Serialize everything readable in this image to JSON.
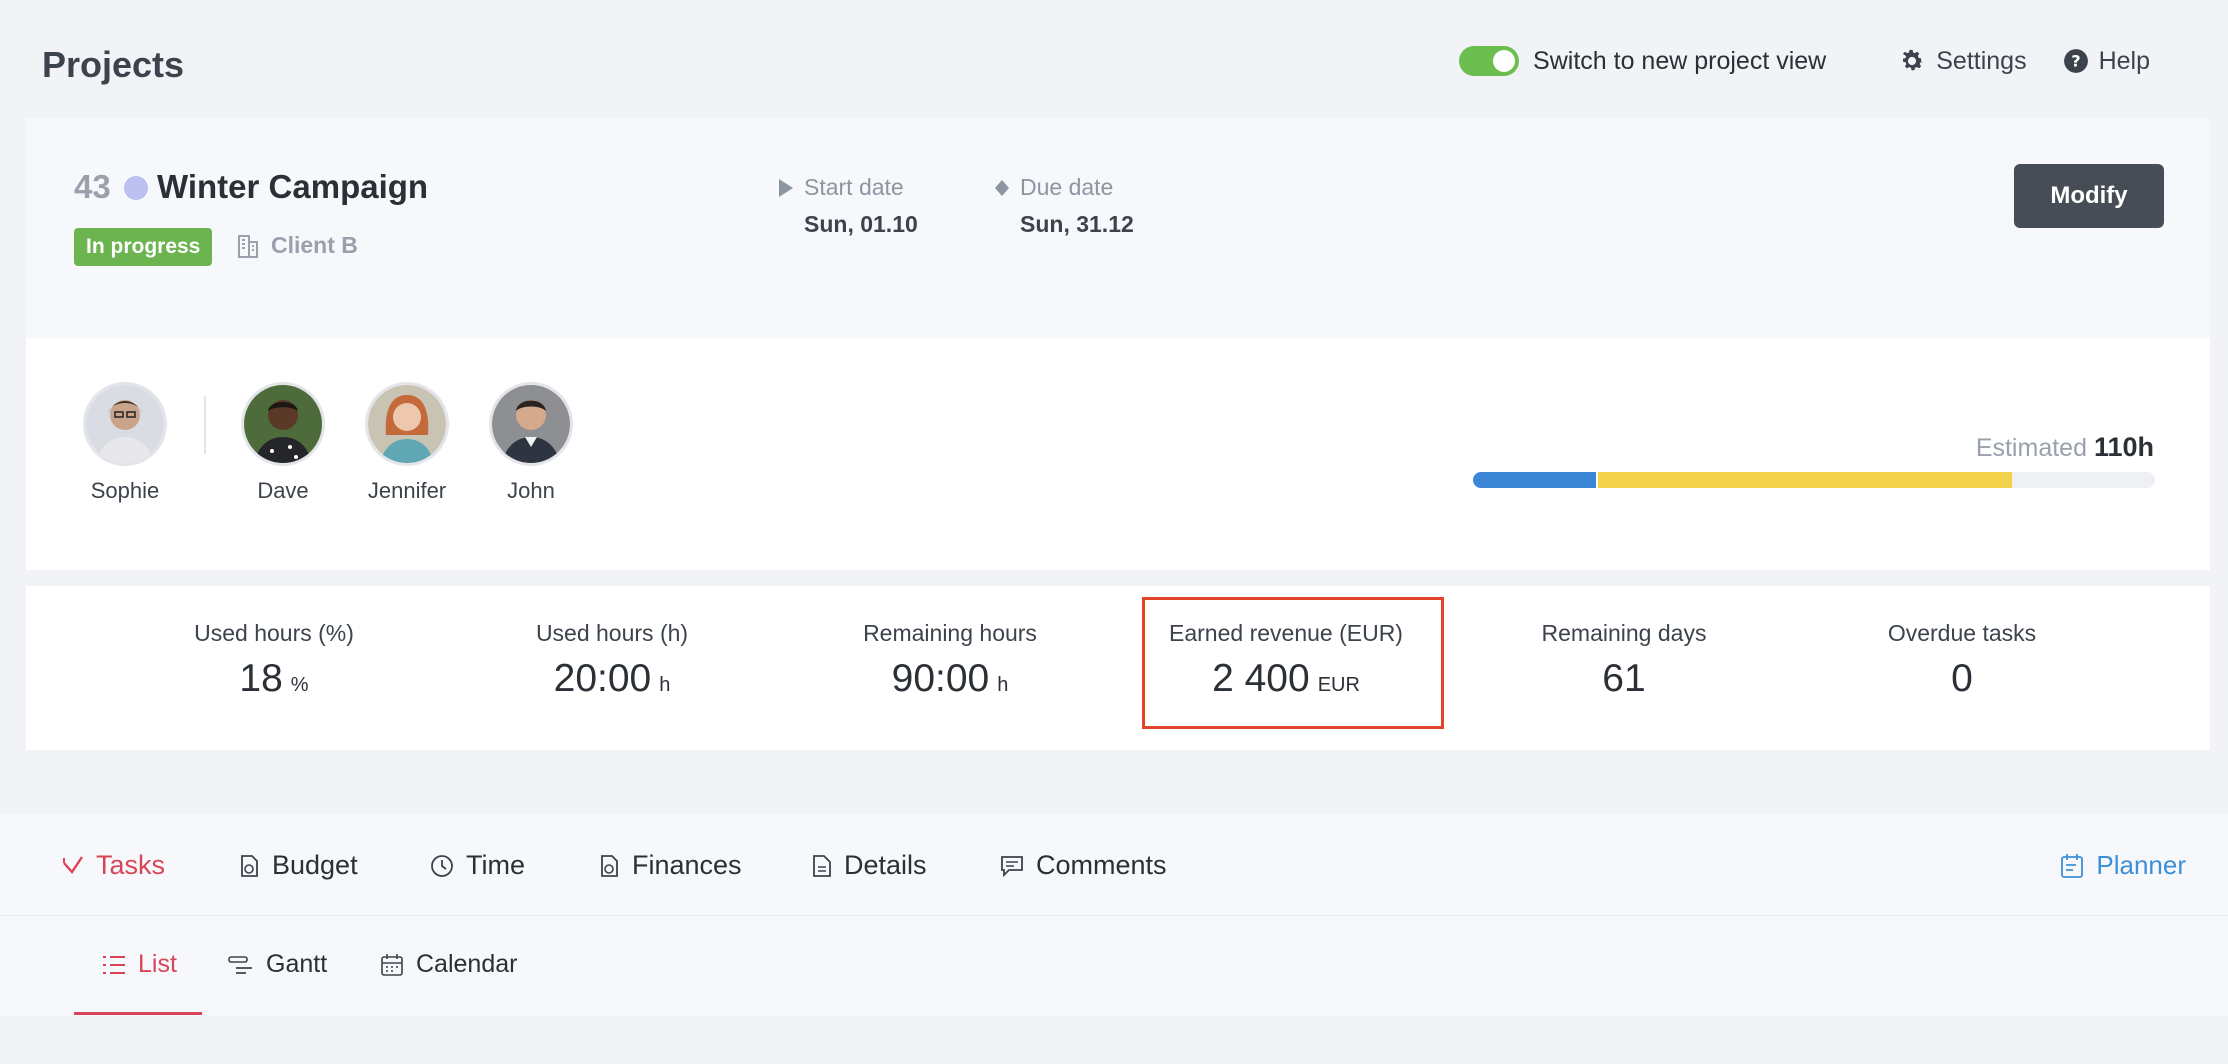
{
  "header": {
    "title": "Projects",
    "toggle_label": "Switch to new project view",
    "toggle_on": true,
    "settings_label": "Settings",
    "help_label": "Help"
  },
  "project": {
    "number": "43",
    "name": "Winter Campaign",
    "status": "In progress",
    "client": "Client B",
    "start_label": "Start date",
    "start_value": "Sun, 01.10",
    "due_label": "Due date",
    "due_value": "Sun, 31.12",
    "modify_label": "Modify",
    "dot_color": "#bcc0ee",
    "status_color": "#6cb44f"
  },
  "team": {
    "members": [
      {
        "name": "Sophie"
      },
      {
        "name": "Dave"
      },
      {
        "name": "Jennifer"
      },
      {
        "name": "John"
      }
    ]
  },
  "estimate": {
    "label": "Estimated",
    "value": "110h",
    "segments": [
      {
        "fraction": 0.18,
        "color": "#3c86d6"
      },
      {
        "fraction": 0.61,
        "color": "#f5d24b"
      }
    ]
  },
  "stats": [
    {
      "label": "Used hours (%)",
      "value": "18",
      "unit": "%"
    },
    {
      "label": "Used hours (h)",
      "value": "20:00",
      "unit": "h"
    },
    {
      "label": "Remaining hours",
      "value": "90:00",
      "unit": "h"
    },
    {
      "label": "Earned revenue (EUR)",
      "value": "2 400",
      "unit": "EUR"
    },
    {
      "label": "Remaining days",
      "value": "61",
      "unit": ""
    },
    {
      "label": "Overdue tasks",
      "value": "0",
      "unit": ""
    }
  ],
  "tabs": [
    {
      "label": "Tasks",
      "icon": "check-icon",
      "active": true
    },
    {
      "label": "Budget",
      "icon": "budget-icon"
    },
    {
      "label": "Time",
      "icon": "clock-icon"
    },
    {
      "label": "Finances",
      "icon": "finances-icon"
    },
    {
      "label": "Details",
      "icon": "document-icon"
    },
    {
      "label": "Comments",
      "icon": "comment-icon"
    }
  ],
  "planner_label": "Planner",
  "subtabs": [
    {
      "label": "List",
      "icon": "list-icon",
      "active": true
    },
    {
      "label": "Gantt",
      "icon": "gantt-icon"
    },
    {
      "label": "Calendar",
      "icon": "calendar-icon"
    }
  ],
  "colors": {
    "accent": "#d94457",
    "link": "#3d8fd6",
    "highlight": "#e0442b",
    "toggle": "#6cbf4f"
  }
}
